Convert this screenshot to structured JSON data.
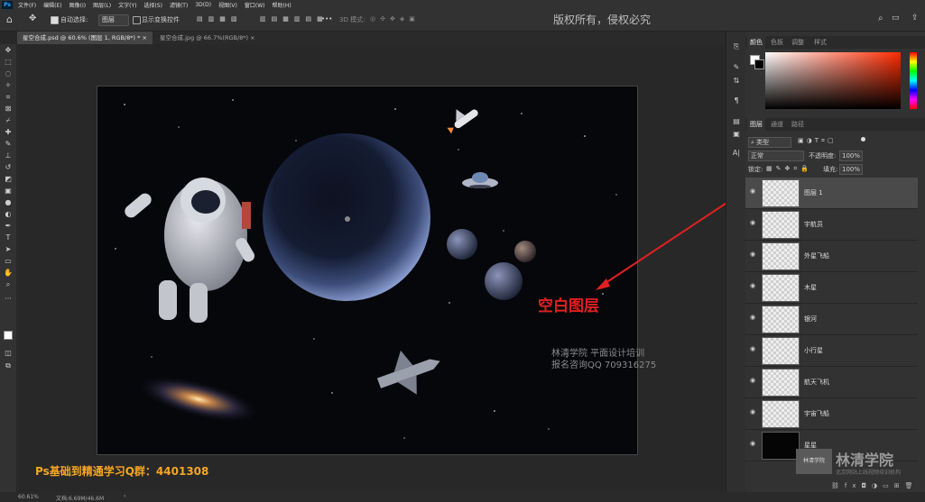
{
  "menubar": {
    "app_icon": "Ps",
    "items": [
      "文件(F)",
      "编辑(E)",
      "图像(I)",
      "图层(L)",
      "文字(Y)",
      "选择(S)",
      "滤镜(T)",
      "3D(D)",
      "视图(V)",
      "窗口(W)",
      "帮助(H)"
    ]
  },
  "options": {
    "auto_select_label": "自动选择:",
    "auto_select_value": "图层",
    "transform_label": "显示变换控件",
    "mode_3d": "3D 模式:",
    "copyright": "版权所有，侵权必究"
  },
  "tabs": [
    {
      "label": "星空合成.psd @ 60.6% (图层 1, RGB/8*) *",
      "active": true
    },
    {
      "label": "星空合成.jpg @ 66.7%(RGB/8*)",
      "active": false
    }
  ],
  "canvas": {
    "annotation": "空白图层",
    "watermark_line1": "林清学院  平面设计培训",
    "watermark_line2": "报名咨询QQ 709316275"
  },
  "overlay_text": "Ps基础到精通学习Q群：4401308",
  "status": {
    "zoom": "60.61%",
    "doc": "文档:6.69M/46.6M"
  },
  "color_panel": {
    "tabs": [
      "颜色",
      "色板",
      "调整",
      "样式"
    ]
  },
  "layers_panel": {
    "tabs": [
      "图层",
      "通道",
      "路径"
    ],
    "filter_kind": "类型",
    "blend_mode": "正常",
    "opacity_label": "不透明度:",
    "opacity_value": "100%",
    "lock_label": "锁定:",
    "fill_label": "填充:",
    "fill_value": "100%",
    "layers": [
      {
        "name": "图层 1",
        "selected": true
      },
      {
        "name": "宇航员",
        "selected": false
      },
      {
        "name": "外星飞船",
        "selected": false
      },
      {
        "name": "木星",
        "selected": false
      },
      {
        "name": "银河",
        "selected": false
      },
      {
        "name": "小行星",
        "selected": false
      },
      {
        "name": "航天飞机",
        "selected": false
      },
      {
        "name": "宇宙飞船",
        "selected": false
      },
      {
        "name": "星星",
        "selected": false
      }
    ]
  },
  "brand": {
    "name": "林清学院",
    "tagline": "北京网站上线视频培训机构",
    "logo_text": "林清学院"
  },
  "colors": {
    "accent_red": "#e02020",
    "overlay_orange": "#f5a623",
    "selection": "#4a4a4a"
  }
}
